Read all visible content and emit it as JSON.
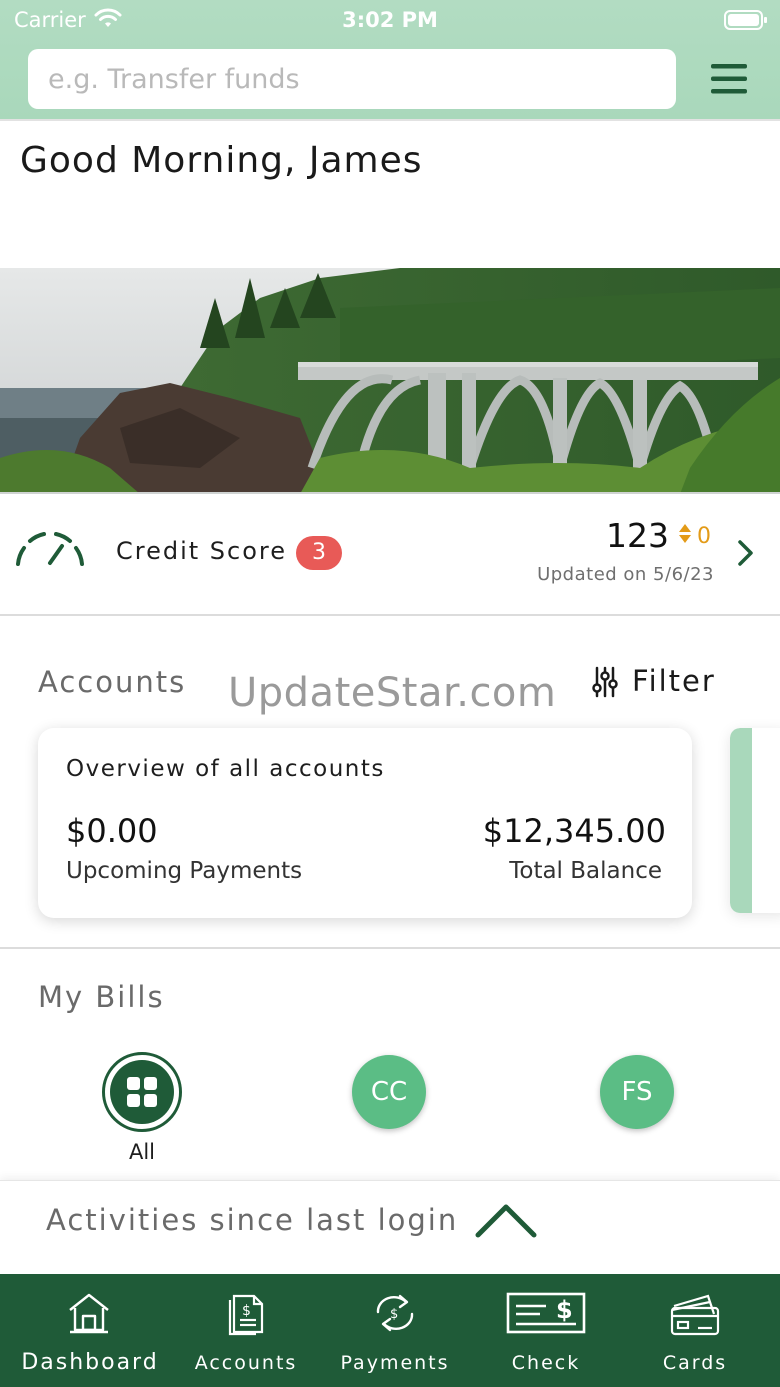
{
  "status_bar": {
    "carrier": "Carrier",
    "time": "3:02 PM"
  },
  "search": {
    "placeholder": "e.g. Transfer funds"
  },
  "greeting": "Good Morning, James",
  "credit_score": {
    "label": "Credit Score",
    "badge_count": "3",
    "score": "123",
    "change": "0",
    "updated": "Updated on 5/6/23"
  },
  "accounts": {
    "title": "Accounts",
    "filter_label": "Filter",
    "watermark": "UpdateStar.com",
    "overview": {
      "title": "Overview of all accounts",
      "upcoming_amount": "$0.00",
      "upcoming_label": "Upcoming Payments",
      "total_amount": "$12,345.00",
      "total_label": "Total Balance"
    }
  },
  "bills": {
    "title": "My Bills",
    "all_label": "All",
    "items": [
      {
        "initials": "CC"
      },
      {
        "initials": "FS"
      }
    ]
  },
  "activities": {
    "label": "Activities since last login"
  },
  "tabbar": {
    "items": [
      {
        "label": "Dashboard",
        "icon": "home-icon"
      },
      {
        "label": "Accounts",
        "icon": "document-dollar-icon"
      },
      {
        "label": "Payments",
        "icon": "transfer-icon"
      },
      {
        "label": "Check",
        "icon": "check-icon"
      },
      {
        "label": "Cards",
        "icon": "cards-icon"
      }
    ]
  },
  "colors": {
    "header_bg": "#a9d8bb",
    "brand_dark_green": "#1f5b38",
    "bill_green": "#5bbd85",
    "badge_red": "#e85a57",
    "score_change_orange": "#e39b18"
  }
}
